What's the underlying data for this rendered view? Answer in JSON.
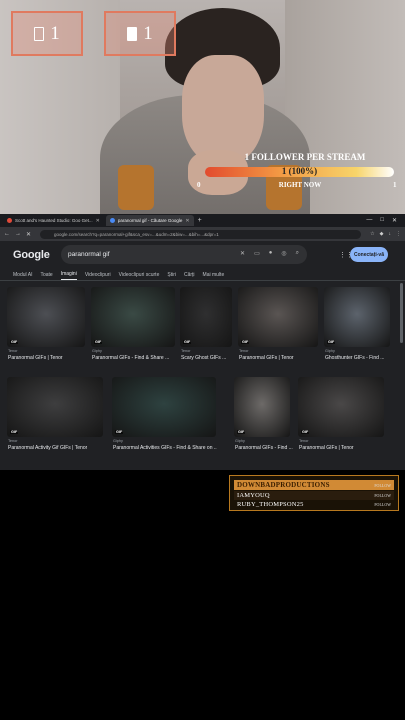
{
  "overlay": {
    "counter_left": {
      "value": "1",
      "icon": "door-icon"
    },
    "counter_right": {
      "value": "1",
      "icon": "document-icon"
    },
    "goal": {
      "title": "1 FOLLOWER PER STREAM",
      "bar_text": "1 (100%)",
      "progress": 1.0,
      "min": "0",
      "max": "1",
      "label": "RIGHT NOW"
    }
  },
  "browser": {
    "tabs": [
      {
        "label": "Scott and's Haunted Studio: Goo Get...",
        "icon": "youtube-icon",
        "active": false
      },
      {
        "label": "paranormal gif - Căutare Google",
        "icon": "google-icon",
        "active": true
      }
    ],
    "new_tab": "+",
    "window_controls": [
      "—",
      "□",
      "✕"
    ],
    "url": "google.com/search?q=paranormal+gif&sca_esv=...&udm=2&biw=...&bih=...&dpr=1",
    "google": {
      "logo": "Google",
      "query": "paranormal gif",
      "sign_in": "Conectați-vă",
      "tabs": [
        "Modul AI",
        "Toate",
        "Imagini",
        "Videoclipuri",
        "Videoclipuri scurte",
        "Știri",
        "Cărți",
        "Mai multe"
      ],
      "active_tab": "Imagini"
    },
    "results_row1": [
      {
        "source": "Tenor",
        "caption": "Paranormal GIFs | Tenor",
        "badge": "GIF",
        "color": "#4d4f54"
      },
      {
        "source": "Giphy",
        "caption": "Paranormal GIFs - Find & Share ...",
        "badge": "GIF",
        "color": "#3a4a45"
      },
      {
        "source": "Tenor",
        "caption": "Scary Ghost GIFs ...",
        "badge": "GIF",
        "color": "#2f2f30"
      },
      {
        "source": "Tenor",
        "caption": "Paranormal GIFs | Tenor",
        "badge": "GIF",
        "color": "#5a5553"
      },
      {
        "source": "Giphy",
        "caption": "Ghosthunter GIFs - Find ...",
        "badge": "GIF",
        "color": "#5c636c"
      }
    ],
    "results_row2": [
      {
        "source": "Tenor",
        "caption": "Paranormal Activity Gif GIFs | Tenor",
        "badge": "GIF",
        "color": "#3e3e3f"
      },
      {
        "source": "Giphy",
        "caption": "Paranormal Activities GIFs - Find & Share on ...",
        "badge": "GIF",
        "color": "#2e4240"
      },
      {
        "source": "Giphy",
        "caption": "Paranormal GIFs - Find ...",
        "badge": "GIF",
        "color": "#6d6a68"
      },
      {
        "source": "Tenor",
        "caption": "Paranormal GIFs | Tenor",
        "badge": "GIF",
        "color": "#4a4848"
      }
    ]
  },
  "followers": [
    {
      "name": "DOWNBADPRODUCTIONS",
      "tag": "FOLLOW"
    },
    {
      "name": "IAMYOUQ",
      "tag": "FOLLOW"
    },
    {
      "name": "RUBY_THOMPSON25",
      "tag": "FOLLOW"
    }
  ]
}
